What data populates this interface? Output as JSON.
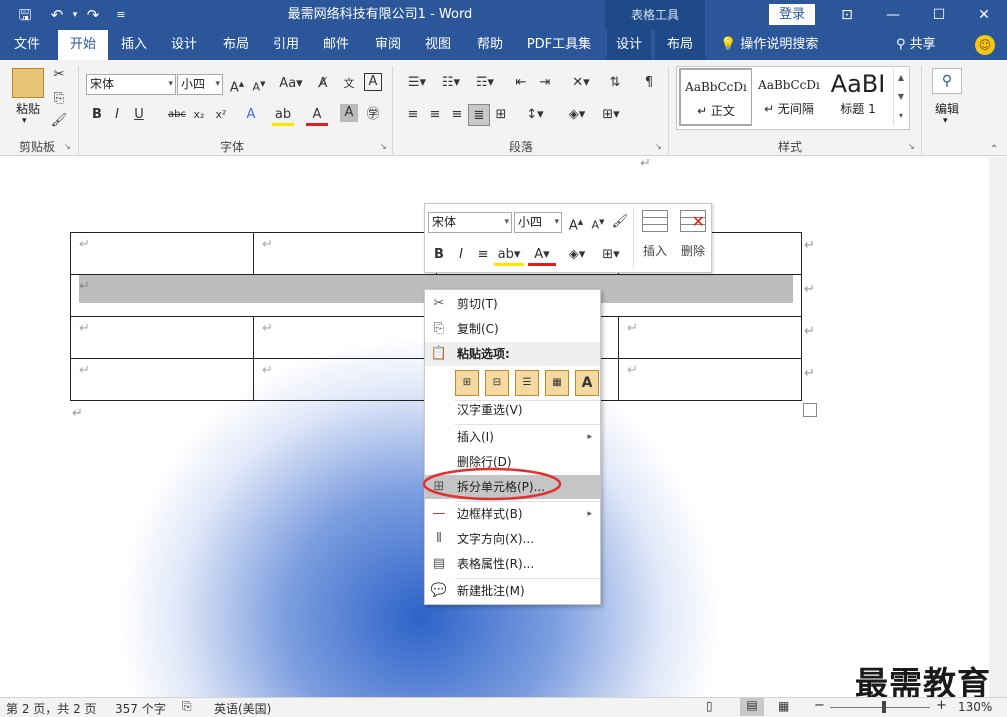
{
  "titlebar": {
    "title": "最需网络科技有限公司1  -  Word",
    "context_tab_group": "表格工具",
    "login_button": "登录",
    "share": "共享",
    "tell_me": "操作说明搜索"
  },
  "tabs": [
    "文件",
    "开始",
    "插入",
    "设计",
    "布局",
    "引用",
    "邮件",
    "审阅",
    "视图",
    "帮助",
    "PDF工具集",
    "设计",
    "布局"
  ],
  "active_tab": "开始",
  "ribbon": {
    "groups": {
      "clipboard": "剪贴板",
      "font": "字体",
      "paragraph": "段落",
      "styles": "样式"
    },
    "paste_label": "粘贴",
    "font_name": "宋体",
    "font_size": "小四",
    "styles": [
      {
        "preview": "AaBbCcDı",
        "name": "↵ 正文"
      },
      {
        "preview": "AaBbCcDı",
        "name": "↵ 无间隔"
      },
      {
        "preview": "AaBI",
        "name": "标题 1"
      }
    ],
    "edit_label": "编辑"
  },
  "minibar": {
    "font_name": "宋体",
    "font_size": "小四",
    "insert_label": "插入",
    "delete_label": "删除"
  },
  "context_menu": {
    "items": [
      {
        "label": "剪切(T)",
        "icon": "cut-icon"
      },
      {
        "label": "复制(C)",
        "icon": "copy-icon"
      },
      {
        "label": "粘贴选项:",
        "icon": "paste-icon"
      },
      {
        "label": "汉字重选(V)",
        "icon": ""
      },
      {
        "label": "插入(I)",
        "icon": ""
      },
      {
        "label": "删除行(D)",
        "icon": ""
      },
      {
        "label": "拆分单元格(P)...",
        "icon": "split-cells-icon"
      },
      {
        "label": "边框样式(B)",
        "icon": "border-icon"
      },
      {
        "label": "文字方向(X)...",
        "icon": "text-direction-icon"
      },
      {
        "label": "表格属性(R)...",
        "icon": "table-properties-icon"
      },
      {
        "label": "新建批注(M)",
        "icon": "comment-icon"
      }
    ]
  },
  "status": {
    "page": "第 2 页，共 2 页",
    "words": "357 个字",
    "lang": "英语(美国)",
    "zoom": "130%"
  },
  "watermark": "最需教育",
  "colors": {
    "accent": "#2b579a",
    "highlight_ellipse": "#e03030"
  }
}
